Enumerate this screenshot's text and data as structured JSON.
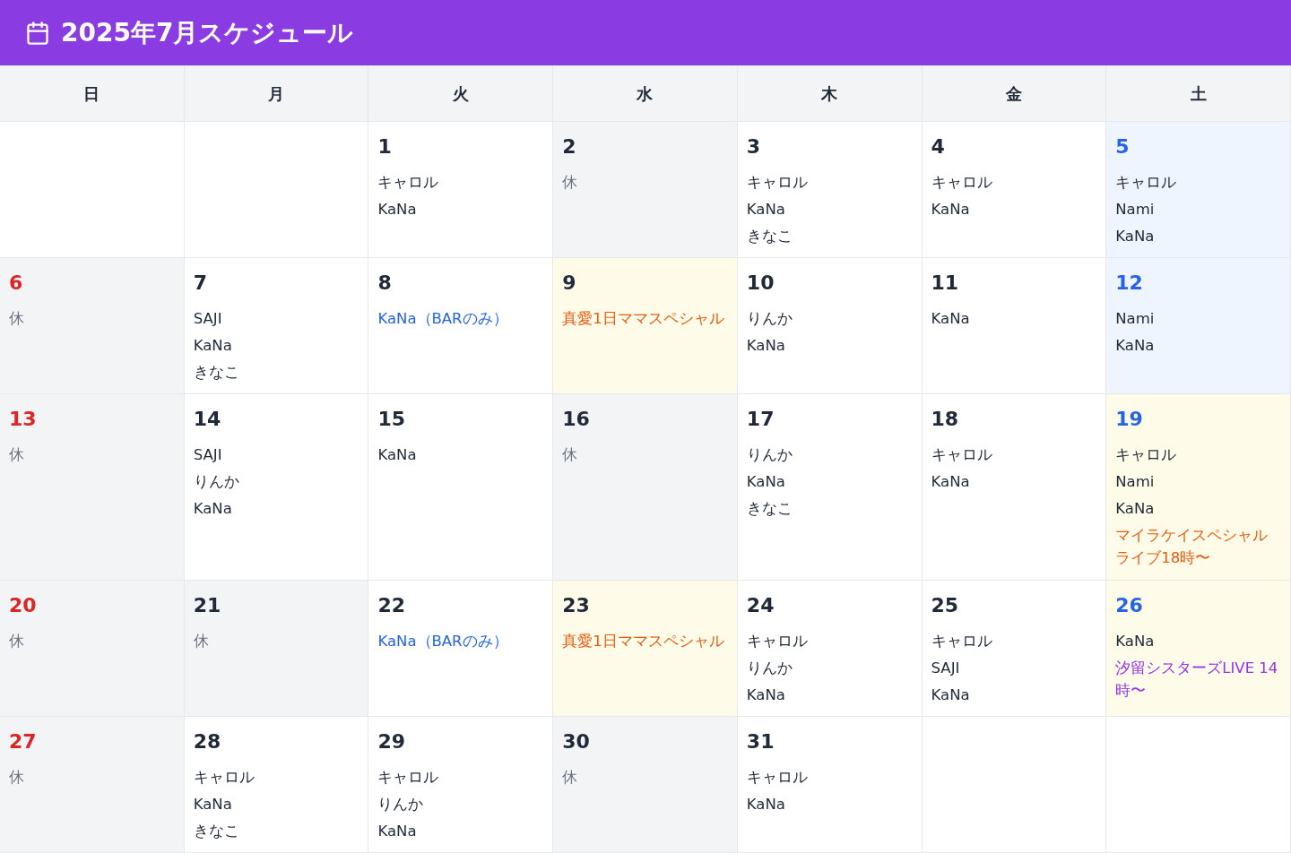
{
  "header": {
    "title": "2025年7月スケジュール"
  },
  "weekdays": [
    "日",
    "月",
    "火",
    "水",
    "木",
    "金",
    "土"
  ],
  "weeks": [
    [
      {
        "kind": "empty"
      },
      {
        "kind": "empty"
      },
      {
        "kind": "normal",
        "day": "1",
        "entries": [
          {
            "text": "キャロル",
            "kind": "staff"
          },
          {
            "text": "KaNa",
            "kind": "staff"
          }
        ]
      },
      {
        "kind": "closed",
        "day": "2",
        "entries": [
          {
            "text": "休",
            "kind": "off"
          }
        ]
      },
      {
        "kind": "normal",
        "day": "3",
        "entries": [
          {
            "text": "キャロル",
            "kind": "staff"
          },
          {
            "text": "KaNa",
            "kind": "staff"
          },
          {
            "text": "きなこ",
            "kind": "staff"
          }
        ]
      },
      {
        "kind": "normal",
        "day": "4",
        "entries": [
          {
            "text": "キャロル",
            "kind": "staff"
          },
          {
            "text": "KaNa",
            "kind": "staff"
          }
        ]
      },
      {
        "kind": "saturday",
        "day": "5",
        "entries": [
          {
            "text": "キャロル",
            "kind": "staff"
          },
          {
            "text": "Nami",
            "kind": "staff"
          },
          {
            "text": "KaNa",
            "kind": "staff"
          }
        ]
      }
    ],
    [
      {
        "kind": "closed",
        "day": "6",
        "entries": [
          {
            "text": "休",
            "kind": "off"
          }
        ]
      },
      {
        "kind": "normal",
        "day": "7",
        "entries": [
          {
            "text": "SAJI",
            "kind": "staff"
          },
          {
            "text": "KaNa",
            "kind": "staff"
          },
          {
            "text": "きなこ",
            "kind": "staff"
          }
        ]
      },
      {
        "kind": "normal",
        "day": "8",
        "entries": [
          {
            "text": "KaNa（BARのみ）",
            "kind": "bar"
          }
        ]
      },
      {
        "kind": "special",
        "day": "9",
        "entries": [
          {
            "text": "真愛1日ママスペシャル",
            "kind": "special"
          }
        ]
      },
      {
        "kind": "normal",
        "day": "10",
        "entries": [
          {
            "text": "りんか",
            "kind": "staff"
          },
          {
            "text": "KaNa",
            "kind": "staff"
          }
        ]
      },
      {
        "kind": "normal",
        "day": "11",
        "entries": [
          {
            "text": "KaNa",
            "kind": "staff"
          }
        ]
      },
      {
        "kind": "saturday",
        "day": "12",
        "entries": [
          {
            "text": "Nami",
            "kind": "staff"
          },
          {
            "text": "KaNa",
            "kind": "staff"
          }
        ]
      }
    ],
    [
      {
        "kind": "closed",
        "day": "13",
        "entries": [
          {
            "text": "休",
            "kind": "off"
          }
        ]
      },
      {
        "kind": "normal",
        "day": "14",
        "entries": [
          {
            "text": "SAJI",
            "kind": "staff"
          },
          {
            "text": "りんか",
            "kind": "staff"
          },
          {
            "text": "KaNa",
            "kind": "staff"
          }
        ]
      },
      {
        "kind": "normal",
        "day": "15",
        "entries": [
          {
            "text": "KaNa",
            "kind": "staff"
          }
        ]
      },
      {
        "kind": "closed",
        "day": "16",
        "entries": [
          {
            "text": "休",
            "kind": "off"
          }
        ]
      },
      {
        "kind": "normal",
        "day": "17",
        "entries": [
          {
            "text": "りんか",
            "kind": "staff"
          },
          {
            "text": "KaNa",
            "kind": "staff"
          },
          {
            "text": "きなこ",
            "kind": "staff"
          }
        ]
      },
      {
        "kind": "normal",
        "day": "18",
        "entries": [
          {
            "text": "キャロル",
            "kind": "staff"
          },
          {
            "text": "KaNa",
            "kind": "staff"
          }
        ]
      },
      {
        "kind": "special",
        "day": "19",
        "entries": [
          {
            "text": "キャロル",
            "kind": "staff"
          },
          {
            "text": "Nami",
            "kind": "staff"
          },
          {
            "text": "KaNa",
            "kind": "staff"
          },
          {
            "text": "マイラケイスペシャルライブ18時〜",
            "kind": "special"
          }
        ]
      }
    ],
    [
      {
        "kind": "closed",
        "day": "20",
        "entries": [
          {
            "text": "休",
            "kind": "off"
          }
        ]
      },
      {
        "kind": "closed",
        "day": "21",
        "entries": [
          {
            "text": "休",
            "kind": "off"
          }
        ]
      },
      {
        "kind": "normal",
        "day": "22",
        "entries": [
          {
            "text": "KaNa（BARのみ）",
            "kind": "bar"
          }
        ]
      },
      {
        "kind": "special",
        "day": "23",
        "entries": [
          {
            "text": "真愛1日ママスペシャル",
            "kind": "special"
          }
        ]
      },
      {
        "kind": "normal",
        "day": "24",
        "entries": [
          {
            "text": "キャロル",
            "kind": "staff"
          },
          {
            "text": "りんか",
            "kind": "staff"
          },
          {
            "text": "KaNa",
            "kind": "staff"
          }
        ]
      },
      {
        "kind": "normal",
        "day": "25",
        "entries": [
          {
            "text": "キャロル",
            "kind": "staff"
          },
          {
            "text": "SAJI",
            "kind": "staff"
          },
          {
            "text": "KaNa",
            "kind": "staff"
          }
        ]
      },
      {
        "kind": "special",
        "day": "26",
        "entries": [
          {
            "text": "KaNa",
            "kind": "staff"
          },
          {
            "text": "汐留シスターズLIVE 14時〜",
            "kind": "live"
          }
        ]
      }
    ],
    [
      {
        "kind": "closed",
        "day": "27",
        "entries": [
          {
            "text": "休",
            "kind": "off"
          }
        ]
      },
      {
        "kind": "normal",
        "day": "28",
        "entries": [
          {
            "text": "キャロル",
            "kind": "staff"
          },
          {
            "text": "KaNa",
            "kind": "staff"
          },
          {
            "text": "きなこ",
            "kind": "staff"
          }
        ]
      },
      {
        "kind": "normal",
        "day": "29",
        "entries": [
          {
            "text": "キャロル",
            "kind": "staff"
          },
          {
            "text": "りんか",
            "kind": "staff"
          },
          {
            "text": "KaNa",
            "kind": "staff"
          }
        ]
      },
      {
        "kind": "closed",
        "day": "30",
        "entries": [
          {
            "text": "休",
            "kind": "off"
          }
        ]
      },
      {
        "kind": "normal",
        "day": "31",
        "entries": [
          {
            "text": "キャロル",
            "kind": "staff"
          },
          {
            "text": "KaNa",
            "kind": "staff"
          }
        ]
      },
      {
        "kind": "empty"
      },
      {
        "kind": "empty"
      }
    ]
  ]
}
